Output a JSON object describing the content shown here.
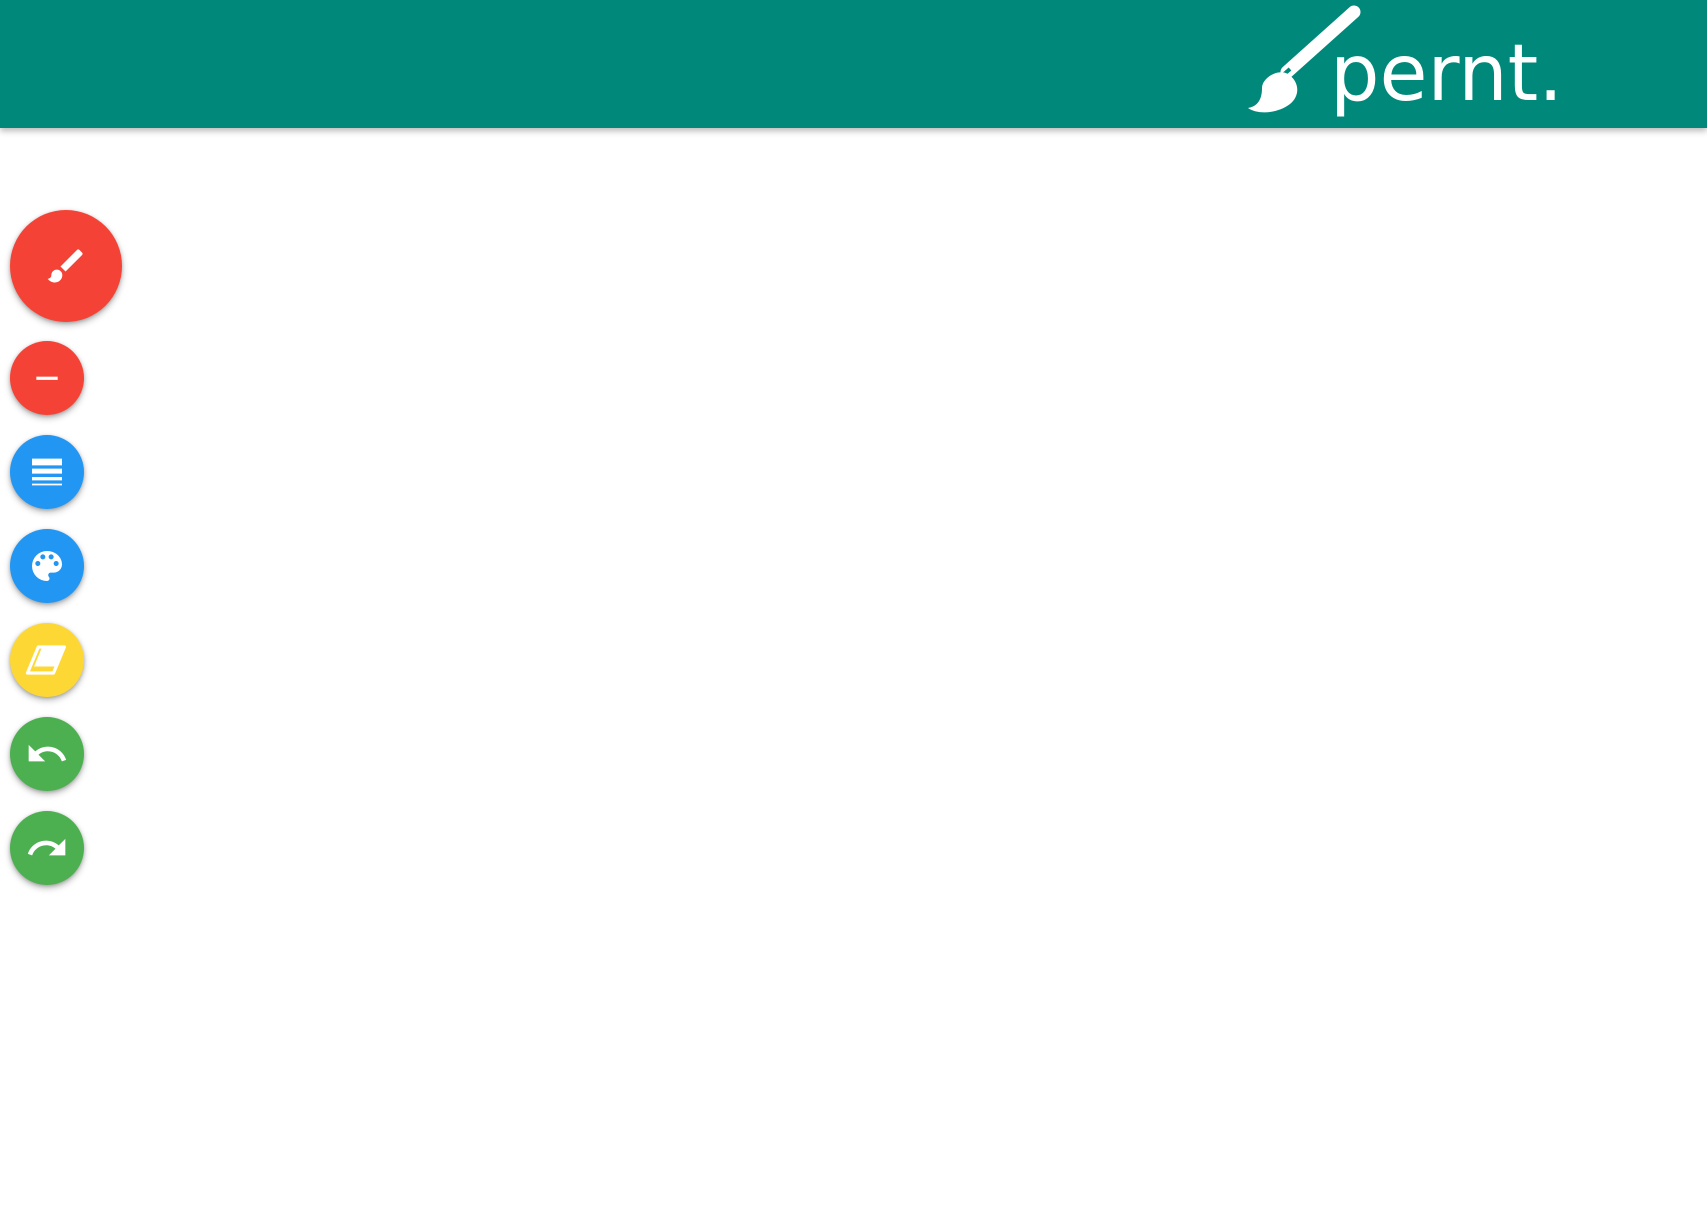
{
  "app": {
    "logo_text": "pernt."
  },
  "colors": {
    "appbar": "#00897b",
    "red": "#f44336",
    "blue": "#2196f3",
    "yellow": "#fdd835",
    "green": "#4caf50",
    "icon": "#ffffff"
  },
  "toolbar": {
    "buttons": [
      {
        "name": "brush-button",
        "icon": "brush-icon",
        "color": "red"
      },
      {
        "name": "line-button",
        "icon": "minus-icon",
        "color": "red"
      },
      {
        "name": "line-width-button",
        "icon": "line-weight-icon",
        "color": "blue"
      },
      {
        "name": "color-palette-button",
        "icon": "palette-icon",
        "color": "blue"
      },
      {
        "name": "eraser-button",
        "icon": "eraser-icon",
        "color": "yellow"
      },
      {
        "name": "undo-button",
        "icon": "undo-icon",
        "color": "green"
      },
      {
        "name": "redo-button",
        "icon": "redo-icon",
        "color": "green"
      }
    ]
  }
}
